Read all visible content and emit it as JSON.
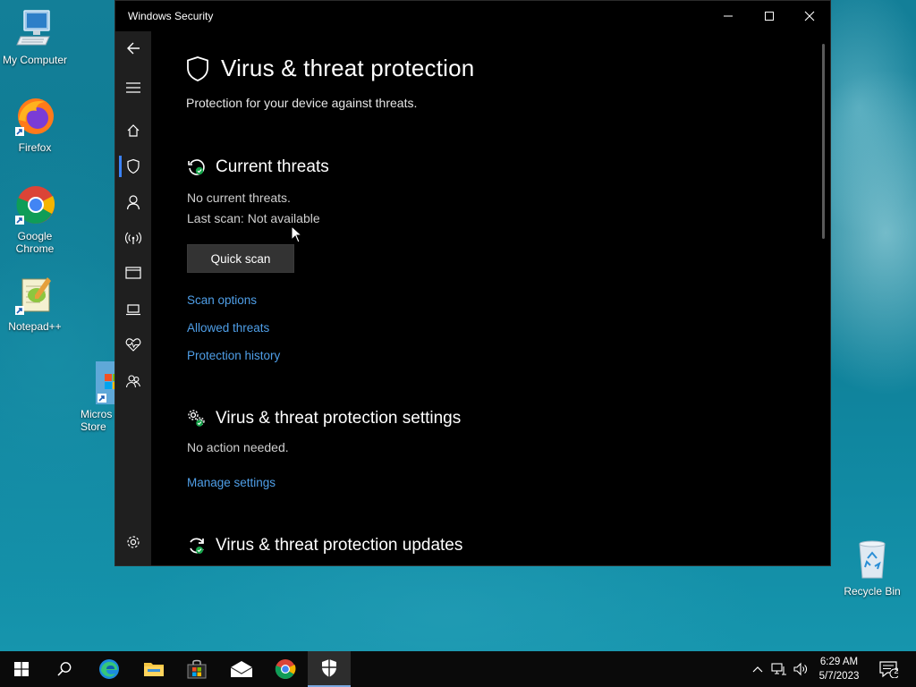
{
  "desktop": {
    "icons": [
      {
        "label": "My Computer"
      },
      {
        "label": "Firefox"
      },
      {
        "label": "Google Chrome"
      },
      {
        "label": "Notepad++"
      },
      {
        "label": "Micros Store"
      },
      {
        "label": "Recycle Bin"
      }
    ]
  },
  "window": {
    "title": "Windows Security",
    "heading": "Virus & threat protection",
    "subtitle": "Protection for your device against threats.",
    "current_threats": {
      "heading": "Current threats",
      "status": "No current threats.",
      "last_scan": "Last scan: Not available",
      "quick_scan_label": "Quick scan",
      "links": [
        "Scan options",
        "Allowed threats",
        "Protection history"
      ]
    },
    "settings": {
      "heading": "Virus & threat protection settings",
      "status": "No action needed.",
      "link": "Manage settings"
    },
    "updates": {
      "heading": "Virus & threat protection updates"
    },
    "nav_icons": [
      "back-arrow-icon",
      "hamburger-menu-icon",
      "home-icon",
      "shield-icon",
      "person-icon",
      "wireless-icon",
      "app-browser-icon",
      "laptop-icon",
      "heart-health-icon",
      "family-icon",
      "settings-gear-icon"
    ]
  },
  "taskbar": {
    "time": "6:29 AM",
    "date": "5/7/2023",
    "notification_count": "2"
  },
  "colors": {
    "accent_link": "#4f9fe8",
    "active_nav": "#3b82f6",
    "window_bg": "#000000",
    "nav_bg": "#1f1f1f"
  }
}
